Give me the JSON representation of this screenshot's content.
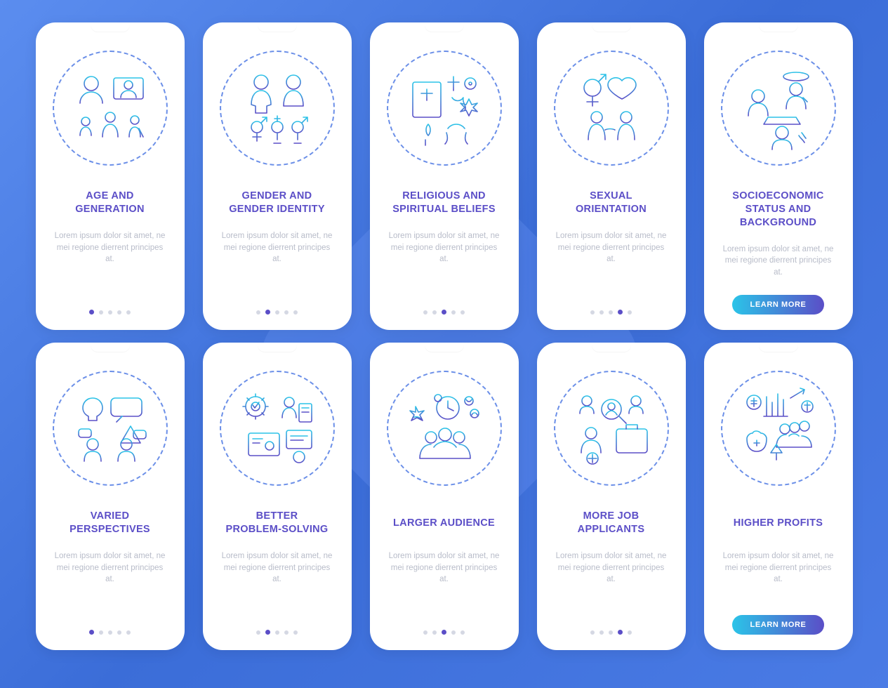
{
  "description": "Lorem ipsum dolor sit amet, ne mei regione dierrent principes at.",
  "button_label": "LEARN MORE",
  "cards": [
    {
      "id": "age",
      "title": "AGE AND\nGENERATION",
      "active_dot": 0,
      "has_button": false
    },
    {
      "id": "gender",
      "title": "GENDER AND\nGENDER IDENTITY",
      "active_dot": 1,
      "has_button": false
    },
    {
      "id": "religion",
      "title": "RELIGIOUS AND\nSPIRITUAL BELIEFS",
      "active_dot": 2,
      "has_button": false
    },
    {
      "id": "orientation",
      "title": "SEXUAL\nORIENTATION",
      "active_dot": 3,
      "has_button": false
    },
    {
      "id": "socio",
      "title": "SOCIOECONOMIC\nSTATUS AND\nBACKGROUND",
      "active_dot": 4,
      "has_button": true
    },
    {
      "id": "perspectives",
      "title": "VARIED\nPERSPECTIVES",
      "active_dot": 0,
      "has_button": false
    },
    {
      "id": "problem",
      "title": "BETTER\nPROBLEM-SOLVING",
      "active_dot": 1,
      "has_button": false
    },
    {
      "id": "audience",
      "title": "LARGER AUDIENCE",
      "active_dot": 2,
      "has_button": false
    },
    {
      "id": "applicants",
      "title": "MORE JOB\nAPPLICANTS",
      "active_dot": 3,
      "has_button": false
    },
    {
      "id": "profits",
      "title": "HIGHER PROFITS",
      "active_dot": 4,
      "has_button": true
    }
  ]
}
